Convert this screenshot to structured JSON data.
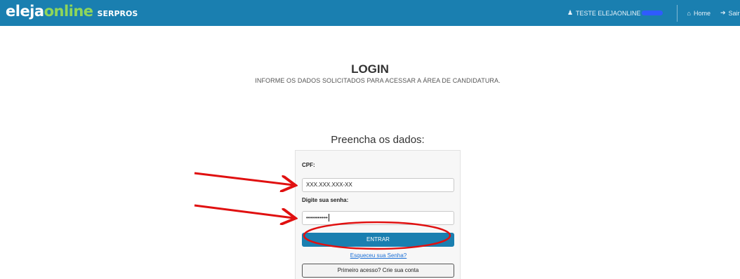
{
  "header": {
    "brand": {
      "part1": "eleja",
      "part2": "online",
      "org": "SERPROS"
    },
    "user_label": "TESTE ELEJAONLINE",
    "home_label": "Home",
    "exit_label": "Sair",
    "colors": {
      "bar": "#1a7fb0",
      "accent": "#8fd65a"
    }
  },
  "page": {
    "title": "LOGIN",
    "subtitle": "INFORME OS DADOS SOLICITADOS PARA ACESSAR A ÁREA DE CANDIDATURA."
  },
  "form": {
    "heading": "Preencha os dados:",
    "cpf_label": "CPF:",
    "cpf_value": "XXX.XXX.XXX-XX",
    "password_label": "Digite sua senha:",
    "password_value": "•••••••••••",
    "submit_label": "ENTRAR",
    "forgot_label": "Esqueceu sua Senha?",
    "create_account_label": "Primeiro acesso? Crie sua conta"
  },
  "annotations": {
    "color": "#e01010"
  }
}
